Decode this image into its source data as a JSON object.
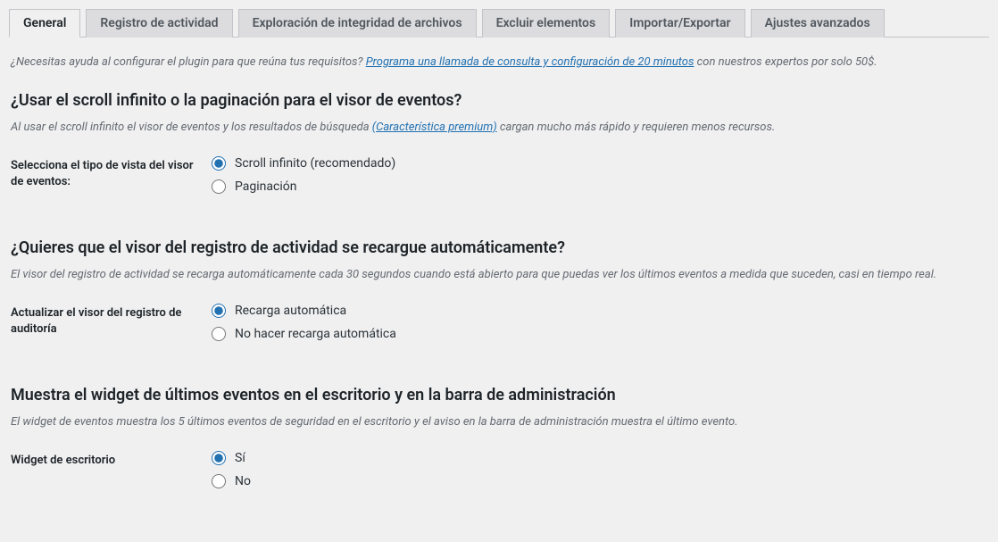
{
  "tabs": [
    {
      "label": "General"
    },
    {
      "label": "Registro de actividad"
    },
    {
      "label": "Exploración de integridad de archivos"
    },
    {
      "label": "Excluir elementos"
    },
    {
      "label": "Importar/Exportar"
    },
    {
      "label": "Ajustes avanzados"
    }
  ],
  "help": {
    "prefix": "¿Necesitas ayuda al configurar el plugin para que reúna tus requisitos? ",
    "link": "Programa una llamada de consulta y configuración de 20 minutos",
    "suffix": " con nuestros expertos por solo 50$."
  },
  "section1": {
    "heading": "¿Usar el scroll infinito o la paginación para el visor de eventos?",
    "desc_prefix": "Al usar el scroll infinito el visor de eventos y los resultados de búsqueda ",
    "desc_link": "(Característica premium)",
    "desc_suffix": " cargan mucho más rápido y requieren menos recursos.",
    "field_label": "Selecciona el tipo de vista del visor de eventos:",
    "opt1": "Scroll infinito (recomendado)",
    "opt2": "Paginación"
  },
  "section2": {
    "heading": "¿Quieres que el visor del registro de actividad se recargue automáticamente?",
    "desc": "El visor del registro de actividad se recarga automáticamente cada 30 segundos cuando está abierto para que puedas ver los últimos eventos a medida que suceden, casi en tiempo real.",
    "field_label": "Actualizar el visor del registro de auditoría",
    "opt1": "Recarga automática",
    "opt2": "No hacer recarga automática"
  },
  "section3": {
    "heading": "Muestra el widget de últimos eventos en el escritorio y en la barra de administración",
    "desc": "El widget de eventos muestra los 5 últimos eventos de seguridad en el escritorio y el aviso en la barra de administración muestra el último evento.",
    "field_label": "Widget de escritorio",
    "opt1": "Sí",
    "opt2": "No"
  }
}
